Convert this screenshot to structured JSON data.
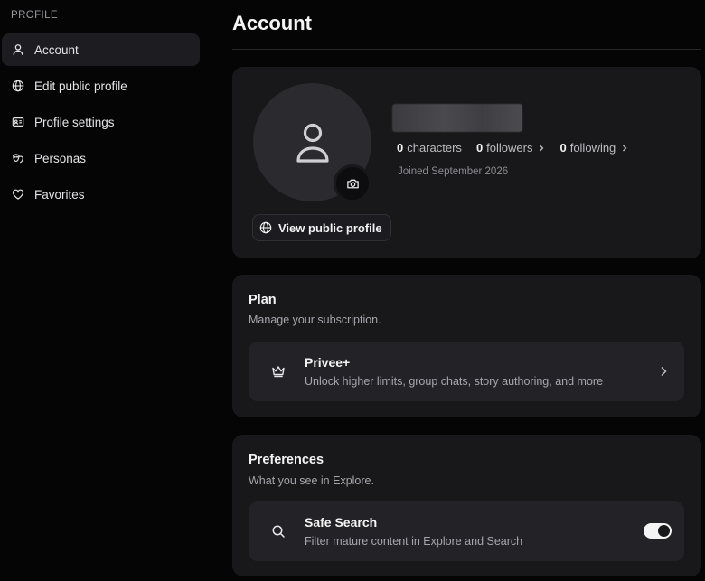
{
  "sidebar": {
    "heading": "PROFILE",
    "items": [
      {
        "label": "Account",
        "icon": "user-icon",
        "active": true
      },
      {
        "label": "Edit public profile",
        "icon": "globe-icon"
      },
      {
        "label": "Profile settings",
        "icon": "id-card-icon"
      },
      {
        "label": "Personas",
        "icon": "masks-icon"
      },
      {
        "label": "Favorites",
        "icon": "heart-icon"
      }
    ]
  },
  "page": {
    "title": "Account"
  },
  "profile": {
    "stats": [
      {
        "value": "0",
        "label": "characters"
      },
      {
        "value": "0",
        "label": "followers"
      },
      {
        "value": "0",
        "label": "following"
      }
    ],
    "joined": "Joined September 2026",
    "view_button": "View public profile"
  },
  "plan": {
    "title": "Plan",
    "subtitle": "Manage your subscription.",
    "item_title": "Privee+",
    "item_desc": "Unlock higher limits, group chats, story authoring, and more",
    "item_icon": "crown-icon"
  },
  "preferences": {
    "title": "Preferences",
    "subtitle": "What you see in Explore.",
    "item_title": "Safe Search",
    "item_desc": "Filter mature content in Explore and Search",
    "item_icon": "search-icon",
    "toggle_on": true
  },
  "colors": {
    "background": "#050505",
    "card": "#18181b",
    "row": "#232327",
    "accent": "#f4f4f5"
  }
}
